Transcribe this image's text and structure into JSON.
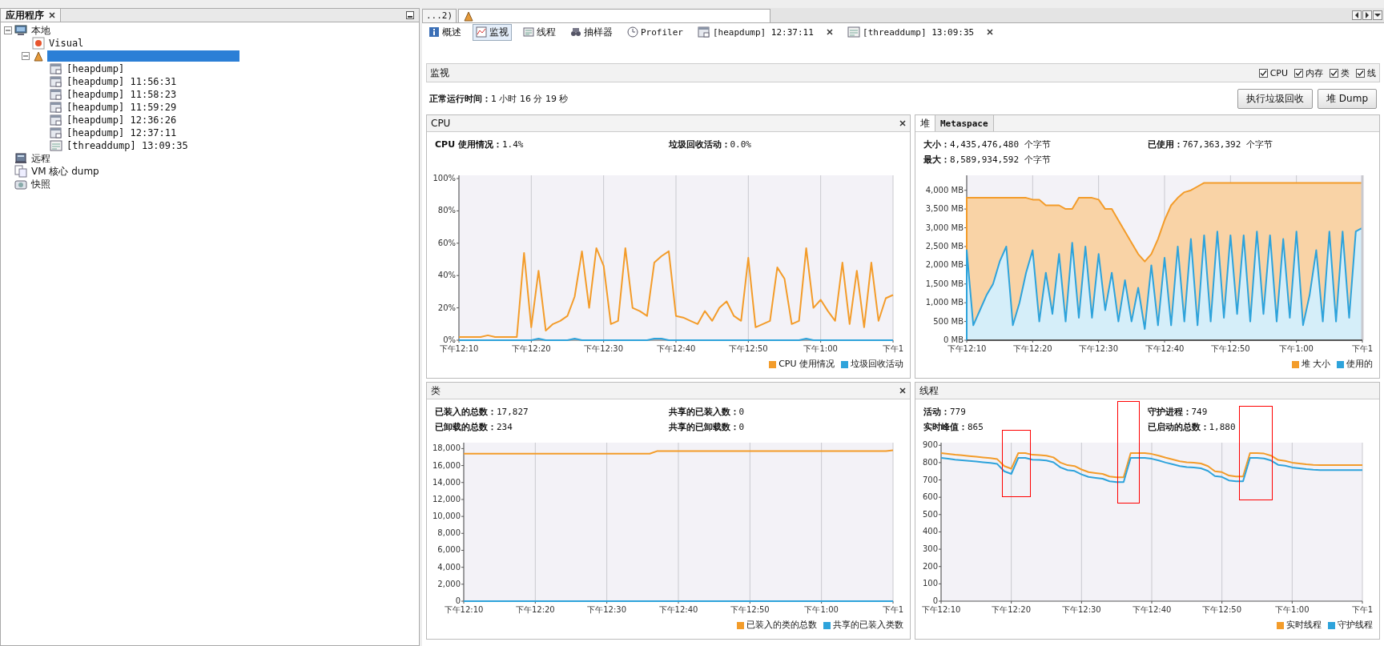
{
  "sidebar": {
    "tab": {
      "label": "应用程序",
      "closable": true
    },
    "items": [
      {
        "label": "本地",
        "kind": "computer",
        "expanded": true,
        "selected": false,
        "children": [
          {
            "label": "Visual",
            "kind": "visualvm",
            "selected": false
          },
          {
            "kind": "app",
            "expanded": true,
            "selected": true,
            "children": [
              {
                "label": "[heapdump]",
                "kind": "heapdump",
                "selected": false
              },
              {
                "label": "[heapdump] 11:56:31",
                "kind": "heapdump",
                "selected": false
              },
              {
                "label": "[heapdump] 11:58:23",
                "kind": "heapdump",
                "selected": false
              },
              {
                "label": "[heapdump] 11:59:29",
                "kind": "heapdump",
                "selected": false
              },
              {
                "label": "[heapdump] 12:36:26",
                "kind": "heapdump",
                "selected": false
              },
              {
                "label": "[heapdump] 12:37:11",
                "kind": "heapdump",
                "selected": false
              },
              {
                "label": "[threaddump] 13:09:35",
                "kind": "threaddump",
                "selected": false
              }
            ]
          }
        ]
      },
      {
        "label": "远程",
        "kind": "remote",
        "selected": false
      },
      {
        "label": "VM 核心 dump",
        "kind": "coredump",
        "selected": false
      },
      {
        "label": "快照",
        "kind": "snapshot",
        "selected": false
      }
    ]
  },
  "editor_tabs": [
    {
      "label": "...2)",
      "selected": false
    },
    {
      "kind": "app",
      "selected": true
    }
  ],
  "view_tabs": [
    {
      "label": "概述",
      "kind": "overview",
      "selected": false
    },
    {
      "label": "监视",
      "kind": "monitor",
      "selected": true
    },
    {
      "label": "线程",
      "kind": "threads",
      "selected": false
    },
    {
      "label": "抽样器",
      "kind": "sampler",
      "selected": false
    },
    {
      "label": "Profiler",
      "kind": "profiler",
      "selected": false
    },
    {
      "label": "[heapdump] 12:37:11",
      "kind": "heapdump",
      "selected": false,
      "closable": true
    },
    {
      "label": "[threaddump] 13:09:35",
      "kind": "threaddump",
      "selected": false,
      "closable": true
    }
  ],
  "monitor": {
    "title": "监视",
    "checkboxes": [
      {
        "label": "CPU",
        "checked": true
      },
      {
        "label": "内存",
        "checked": true
      },
      {
        "label": "类",
        "checked": true
      },
      {
        "label": "线",
        "checked": true
      }
    ],
    "uptime": {
      "label": "正常运行时间：",
      "value": "1 小时 16 分 19 秒"
    },
    "buttons": [
      "执行垃圾回收",
      "堆 Dump"
    ],
    "panels": [
      {
        "title": "CPU",
        "closable": true,
        "stats": [
          {
            "label": "CPU 使用情况：",
            "value": "1.4%"
          },
          {
            "label": "垃圾回收活动：",
            "value": "0.0%"
          }
        ],
        "chart_data": {
          "type": "line",
          "grid": true,
          "ylim": [
            0,
            102
          ],
          "categories": [
            "下午12:10",
            null,
            null,
            null,
            null,
            null,
            null,
            null,
            null,
            null,
            "下午12:20",
            null,
            null,
            null,
            null,
            null,
            null,
            null,
            null,
            null,
            "下午12:30",
            null,
            null,
            null,
            null,
            null,
            null,
            null,
            null,
            null,
            "下午12:40",
            null,
            null,
            null,
            null,
            null,
            null,
            null,
            null,
            null,
            "下午12:50",
            null,
            null,
            null,
            null,
            null,
            null,
            null,
            null,
            null,
            "下午1:00",
            null,
            null,
            null,
            null,
            null,
            null,
            null,
            null,
            null,
            "下午1"
          ],
          "yticks": [
            {
              "value": 0,
              "label": "0%"
            },
            {
              "value": 20,
              "label": "20%"
            },
            {
              "value": 40,
              "label": "40%"
            },
            {
              "value": 60,
              "label": "60%"
            },
            {
              "value": 80,
              "label": "80%"
            },
            {
              "value": 100,
              "label": "100%"
            }
          ],
          "series": [
            {
              "name": "CPU 使用情况",
              "color": "#f39c2a",
              "values": [
                2,
                2,
                2,
                2,
                3,
                2,
                2,
                2,
                2,
                54,
                8,
                43,
                6,
                10,
                12,
                15,
                27,
                55,
                20,
                57,
                46,
                10,
                12,
                57,
                20,
                18,
                15,
                48,
                52,
                55,
                15,
                14,
                12,
                10,
                18,
                12,
                20,
                24,
                15,
                12,
                51,
                8,
                10,
                12,
                45,
                38,
                10,
                12,
                57,
                20,
                25,
                18,
                12,
                48,
                10,
                43,
                8,
                48,
                12,
                26,
                28
              ]
            },
            {
              "name": "垃圾回收活动",
              "color": "#2ea3db",
              "values": [
                0,
                0,
                0,
                0,
                0,
                0,
                0,
                0,
                0,
                0,
                0,
                1,
                0,
                0,
                0,
                0,
                1,
                0,
                0,
                0,
                0,
                0,
                0,
                0,
                0,
                0,
                0,
                1,
                1,
                0,
                0,
                0,
                0,
                0,
                0,
                0,
                0,
                0,
                0,
                0,
                0,
                0,
                0,
                0,
                0,
                0,
                0,
                0,
                1,
                0,
                0,
                0,
                0,
                0,
                0,
                0,
                0,
                0,
                0,
                0,
                0
              ]
            }
          ]
        }
      },
      {
        "tabs": [
          {
            "label": "堆",
            "selected": true
          },
          {
            "label": "Metaspace",
            "selected": false
          }
        ],
        "stats": [
          {
            "label": "大小：",
            "value": "4,435,476,480 个字节"
          },
          {
            "label": "已使用：",
            "value": "767,363,392 个字节"
          },
          {
            "label": "最大：",
            "value": "8,589,934,592 个字节"
          }
        ],
        "chart_data": {
          "type": "area",
          "grid": true,
          "ylim": [
            0,
            4400
          ],
          "categories": [
            "下午12:10",
            null,
            null,
            null,
            null,
            null,
            null,
            null,
            null,
            null,
            "下午12:20",
            null,
            null,
            null,
            null,
            null,
            null,
            null,
            null,
            null,
            "下午12:30",
            null,
            null,
            null,
            null,
            null,
            null,
            null,
            null,
            null,
            "下午12:40",
            null,
            null,
            null,
            null,
            null,
            null,
            null,
            null,
            null,
            "下午12:50",
            null,
            null,
            null,
            null,
            null,
            null,
            null,
            null,
            null,
            "下午1:00",
            null,
            null,
            null,
            null,
            null,
            null,
            null,
            null,
            null,
            "下午1"
          ],
          "yticks": [
            {
              "value": 0,
              "label": "0 MB"
            },
            {
              "value": 500,
              "label": "500 MB"
            },
            {
              "value": 1000,
              "label": "1,000 MB"
            },
            {
              "value": 1500,
              "label": "1,500 MB"
            },
            {
              "value": 2000,
              "label": "2,000 MB"
            },
            {
              "value": 2500,
              "label": "2,500 MB"
            },
            {
              "value": 3000,
              "label": "3,000 MB"
            },
            {
              "value": 3500,
              "label": "3,500 MB"
            },
            {
              "value": 4000,
              "label": "4,000 MB"
            }
          ],
          "series": [
            {
              "name": "堆 大小",
              "color": "#f39c2a",
              "values": [
                3800,
                3800,
                3800,
                3800,
                3800,
                3800,
                3800,
                3800,
                3800,
                3800,
                3750,
                3750,
                3600,
                3600,
                3600,
                3500,
                3500,
                3800,
                3800,
                3800,
                3750,
                3500,
                3500,
                3200,
                2900,
                2600,
                2300,
                2100,
                2300,
                2700,
                3200,
                3600,
                3800,
                3950,
                4000,
                4100,
                4200,
                4200,
                4200,
                4200,
                4200,
                4200,
                4200,
                4200,
                4200,
                4200,
                4200,
                4200,
                4200,
                4200,
                4200,
                4200,
                4200,
                4200,
                4200,
                4200,
                4200,
                4200,
                4200,
                4200,
                4200
              ]
            },
            {
              "name": "使用的",
              "color": "#2ea3db",
              "values": [
                2400,
                400,
                800,
                1200,
                1500,
                2100,
                2500,
                400,
                1000,
                1800,
                2400,
                500,
                1800,
                700,
                2300,
                500,
                2600,
                600,
                2500,
                600,
                2300,
                800,
                1800,
                500,
                1600,
                500,
                1400,
                300,
                2000,
                400,
                2200,
                400,
                2500,
                500,
                2700,
                400,
                2800,
                500,
                2900,
                600,
                2800,
                700,
                2800,
                500,
                2900,
                700,
                2800,
                500,
                2700,
                600,
                2900,
                400,
                1200,
                2400,
                500,
                2900,
                500,
                2900,
                600,
                2900,
                3000
              ]
            }
          ]
        }
      },
      {
        "title": "类",
        "closable": true,
        "stats": [
          {
            "label": "已装入的总数：",
            "value": "17,827"
          },
          {
            "label": "共享的已装入数：",
            "value": "0"
          },
          {
            "label": "已卸载的总数：",
            "value": "234"
          },
          {
            "label": "共享的已卸载数：",
            "value": "0"
          }
        ],
        "chart_data": {
          "type": "line",
          "grid": true,
          "ylim": [
            0,
            18700
          ],
          "categories": [
            "下午12:10",
            null,
            null,
            null,
            null,
            null,
            null,
            null,
            null,
            null,
            "下午12:20",
            null,
            null,
            null,
            null,
            null,
            null,
            null,
            null,
            null,
            "下午12:30",
            null,
            null,
            null,
            null,
            null,
            null,
            null,
            null,
            null,
            "下午12:40",
            null,
            null,
            null,
            null,
            null,
            null,
            null,
            null,
            null,
            "下午12:50",
            null,
            null,
            null,
            null,
            null,
            null,
            null,
            null,
            null,
            "下午1:00",
            null,
            null,
            null,
            null,
            null,
            null,
            null,
            null,
            null,
            "下午1"
          ],
          "yticks": [
            {
              "value": 0,
              "label": "0"
            },
            {
              "value": 2000,
              "label": "2,000"
            },
            {
              "value": 4000,
              "label": "4,000"
            },
            {
              "value": 6000,
              "label": "6,000"
            },
            {
              "value": 8000,
              "label": "8,000"
            },
            {
              "value": 10000,
              "label": "10,000"
            },
            {
              "value": 12000,
              "label": "12,000"
            },
            {
              "value": 14000,
              "label": "14,000"
            },
            {
              "value": 16000,
              "label": "16,000"
            },
            {
              "value": 18000,
              "label": "18,000"
            }
          ],
          "series": [
            {
              "name": "已装入的类的总数",
              "color": "#f39c2a",
              "values": [
                17400,
                17400,
                17400,
                17400,
                17400,
                17400,
                17400,
                17400,
                17400,
                17400,
                17400,
                17400,
                17400,
                17400,
                17400,
                17400,
                17400,
                17400,
                17400,
                17400,
                17400,
                17400,
                17400,
                17400,
                17400,
                17400,
                17400,
                17700,
                17700,
                17700,
                17700,
                17700,
                17700,
                17700,
                17700,
                17700,
                17700,
                17700,
                17700,
                17700,
                17700,
                17700,
                17700,
                17700,
                17700,
                17700,
                17700,
                17700,
                17700,
                17700,
                17700,
                17700,
                17700,
                17700,
                17700,
                17700,
                17700,
                17700,
                17700,
                17700,
                17800
              ]
            },
            {
              "name": "共享的已装入类数",
              "color": "#2ea3db",
              "values": [
                0,
                0,
                0,
                0,
                0,
                0,
                0,
                0,
                0,
                0,
                0,
                0,
                0,
                0,
                0,
                0,
                0,
                0,
                0,
                0,
                0,
                0,
                0,
                0,
                0,
                0,
                0,
                0,
                0,
                0,
                0,
                0,
                0,
                0,
                0,
                0,
                0,
                0,
                0,
                0,
                0,
                0,
                0,
                0,
                0,
                0,
                0,
                0,
                0,
                0,
                0,
                0,
                0,
                0,
                0,
                0,
                0,
                0,
                0,
                0,
                0
              ]
            }
          ]
        }
      },
      {
        "title": "线程",
        "highlights": [
          {
            "color": "#ff0000"
          },
          {
            "color": "#ff0000"
          },
          {
            "color": "#ff0000"
          }
        ],
        "stats": [
          {
            "label": "活动：",
            "value": "779"
          },
          {
            "label": "守护进程：",
            "value": "749"
          },
          {
            "label": "实时峰值：",
            "value": "865"
          },
          {
            "label": "已启动的总数：",
            "value": "1,880"
          }
        ],
        "chart_data": {
          "type": "line",
          "grid": true,
          "ylim": [
            0,
            915
          ],
          "categories": [
            "下午12:10",
            null,
            null,
            null,
            null,
            null,
            null,
            null,
            null,
            null,
            "下午12:20",
            null,
            null,
            null,
            null,
            null,
            null,
            null,
            null,
            null,
            "下午12:30",
            null,
            null,
            null,
            null,
            null,
            null,
            null,
            null,
            null,
            "下午12:40",
            null,
            null,
            null,
            null,
            null,
            null,
            null,
            null,
            null,
            "下午12:50",
            null,
            null,
            null,
            null,
            null,
            null,
            null,
            null,
            null,
            "下午1:00",
            null,
            null,
            null,
            null,
            null,
            null,
            null,
            null,
            null,
            "下午1"
          ],
          "yticks": [
            0,
            100,
            200,
            300,
            400,
            500,
            600,
            700,
            800,
            900
          ],
          "series": [
            {
              "name": "实时线程",
              "color": "#f39c2a",
              "values": [
                855,
                850,
                845,
                842,
                838,
                834,
                830,
                826,
                820,
                780,
                765,
                855,
                855,
                845,
                843,
                840,
                830,
                800,
                785,
                780,
                760,
                745,
                740,
                735,
                720,
                715,
                715,
                855,
                855,
                855,
                850,
                840,
                828,
                818,
                808,
                802,
                800,
                795,
                780,
                750,
                745,
                725,
                720,
                720,
                855,
                855,
                852,
                840,
                815,
                810,
                800,
                795,
                790,
                787,
                785,
                785,
                785,
                785,
                785,
                785,
                785
              ]
            },
            {
              "name": "守护线程",
              "color": "#2ea3db",
              "values": [
                827,
                822,
                817,
                814,
                810,
                806,
                802,
                798,
                792,
                750,
                735,
                827,
                827,
                817,
                815,
                812,
                802,
                772,
                757,
                752,
                732,
                717,
                712,
                707,
                692,
                687,
                687,
                827,
                827,
                827,
                822,
                812,
                800,
                790,
                780,
                774,
                772,
                767,
                752,
                722,
                717,
                697,
                692,
                692,
                827,
                827,
                824,
                812,
                787,
                782,
                772,
                767,
                762,
                759,
                757,
                757,
                757,
                757,
                757,
                757,
                757
              ]
            }
          ]
        }
      }
    ]
  }
}
